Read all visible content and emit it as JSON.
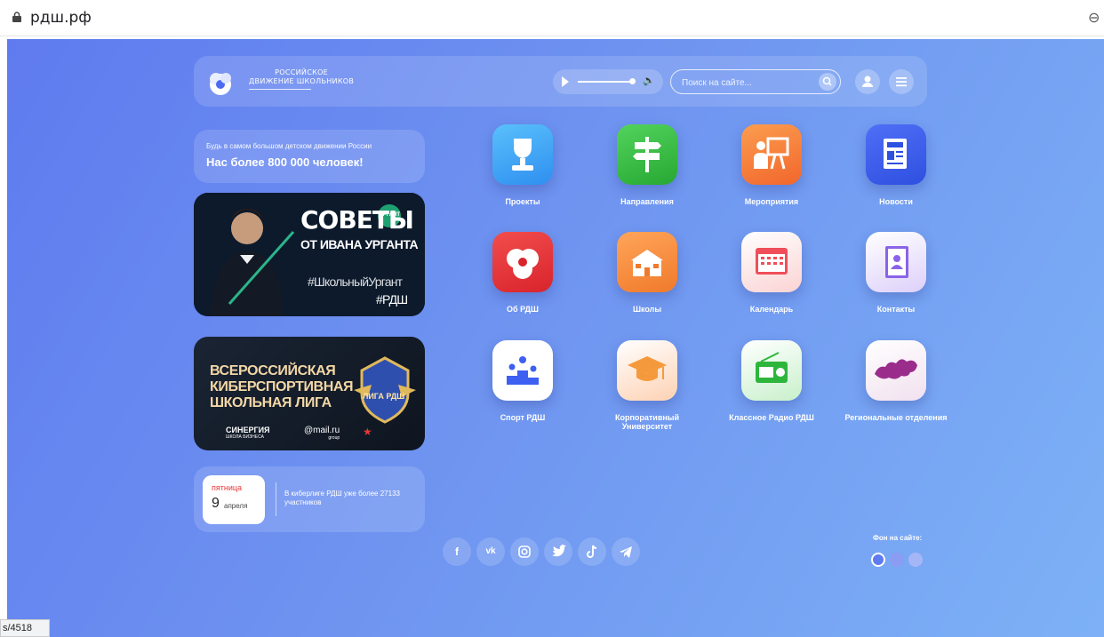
{
  "browser": {
    "url": "рдш.рф",
    "status_text": "s/4518"
  },
  "logo": {
    "line1": "РОССИЙСКОЕ",
    "line2": "ДВИЖЕНИЕ ШКОЛЬНИКОВ"
  },
  "search": {
    "placeholder": "Поиск на сайте..."
  },
  "tagline": {
    "small": "Будь в самом большом детском движении России",
    "big": "Нас более 800 000 человек!"
  },
  "banner1": {
    "title": "СОВЕТЫ",
    "subtitle": "ОТ ИВАНА УРГАНТА",
    "hashtag": "#ШкольныйУргант",
    "hashtag2": "#РДШ",
    "badge": "УРГАНТ"
  },
  "banner2": {
    "line1": "ВСЕРОССИЙСКАЯ",
    "line2": "КИБЕРСПОРТИВНАЯ",
    "line3": "ШКОЛЬНАЯ ЛИГА",
    "emblem": "ЛИГА РДШ",
    "sponsor1": "СИНЕРГИЯ",
    "sponsor1_sub": "ШКОЛА БИЗНЕСА",
    "sponsor2": "@mail.ru",
    "sponsor2_sub": "group"
  },
  "date_card": {
    "weekday": "пятница",
    "day": "9",
    "month": "апреля",
    "note": "В киберлиге РДШ уже более 27133 участников"
  },
  "tiles": [
    {
      "label": "Проекты",
      "icon": "trophy-icon",
      "color": "#3ea6f5"
    },
    {
      "label": "Направления",
      "icon": "signpost-icon",
      "color": "#3bc14a"
    },
    {
      "label": "Мероприятия",
      "icon": "presenter-icon",
      "color": "#f7843a"
    },
    {
      "label": "Новости",
      "icon": "newspaper-icon",
      "color": "#3d5ff2"
    },
    {
      "label": "Об РДШ",
      "icon": "rdsh-logo-icon",
      "color": "#ec3b3b"
    },
    {
      "label": "Школы",
      "icon": "school-icon",
      "color": "#f79340"
    },
    {
      "label": "Календарь",
      "icon": "calendar-icon",
      "color": "#fde6e6"
    },
    {
      "label": "Контакты",
      "icon": "contacts-book-icon",
      "color": "#ece4fb"
    },
    {
      "label": "Спорт РДШ",
      "icon": "podium-icon",
      "color": "#ffffff"
    },
    {
      "label": "Корпоративный Университет",
      "icon": "graduation-cap-icon",
      "color": "#fde2cf"
    },
    {
      "label": "Классное Радио РДШ",
      "icon": "radio-icon",
      "color": "#e2f7e3"
    },
    {
      "label": "Региональные отделения",
      "icon": "russia-map-icon",
      "color": "#f6ecf5"
    }
  ],
  "social": [
    "f",
    "vk",
    "instagram",
    "twitter",
    "tiktok",
    "telegram"
  ],
  "background_picker": {
    "title": "Фон на сайте:",
    "options": [
      "#5f7bef",
      "#8a9df2",
      "#a5b6f6"
    ]
  }
}
